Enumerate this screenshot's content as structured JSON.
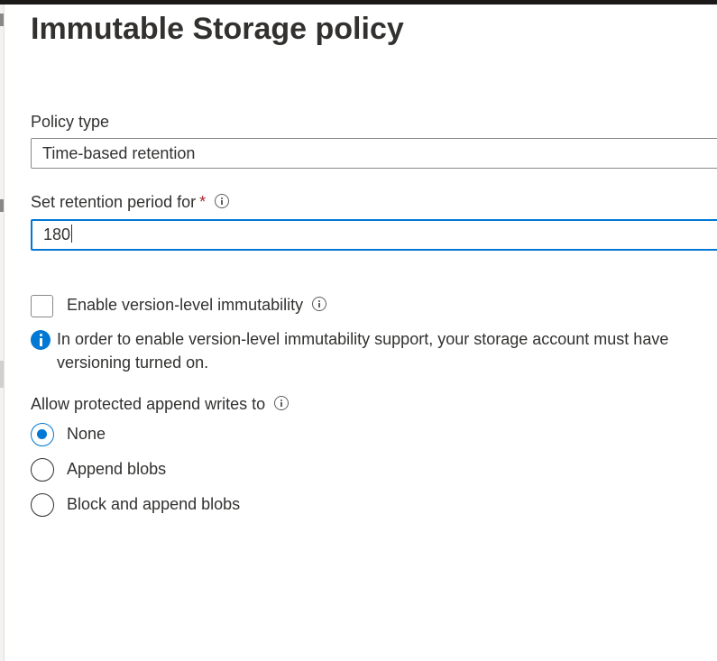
{
  "panel": {
    "title": "Immutable Storage policy"
  },
  "policy_type": {
    "label": "Policy type",
    "selected": "Time-based retention"
  },
  "retention": {
    "label": "Set retention period for",
    "required_mark": "*",
    "value": "180"
  },
  "version_immutability": {
    "label": "Enable version-level immutability",
    "checked": false,
    "info_message": "In order to enable version-level immutability support, your storage account must have versioning turned on."
  },
  "append_writes": {
    "label": "Allow protected append writes to",
    "options": [
      {
        "label": "None",
        "selected": true
      },
      {
        "label": "Append blobs",
        "selected": false
      },
      {
        "label": "Block and append blobs",
        "selected": false
      }
    ]
  },
  "colors": {
    "accent": "#0078d4",
    "required": "#a4262c",
    "text": "#323130"
  }
}
